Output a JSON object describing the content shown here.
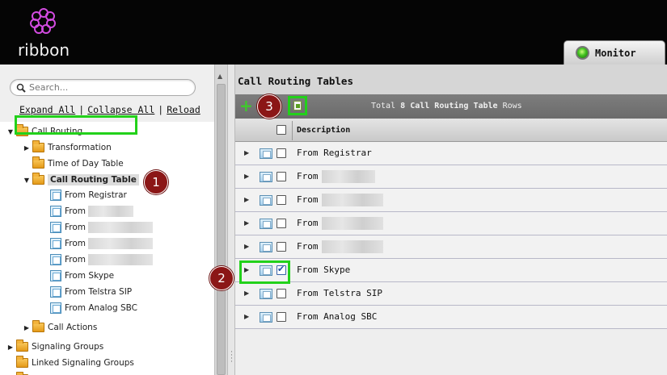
{
  "header": {
    "logo_text": "ribbon",
    "monitor_label": "Monitor"
  },
  "left_panel": {
    "search_placeholder": "Search...",
    "links": {
      "expand_all": "Expand All",
      "collapse_all": "Collapse All",
      "reload": "Reload",
      "separator": "|"
    },
    "tree": {
      "call_routing": "Call Routing",
      "transformation": "Transformation",
      "time_of_day_table": "Time of Day Table",
      "call_routing_table": "Call Routing Table",
      "children": [
        "From Registrar",
        "From",
        "From",
        "From",
        "From",
        "From Skype",
        "From Telstra SIP",
        "From Analog SBC"
      ],
      "call_actions": "Call Actions",
      "signaling_groups": "Signaling Groups",
      "linked_signaling_groups": "Linked Signaling Groups"
    }
  },
  "right_panel": {
    "title": "Call Routing Tables",
    "toolbar": {
      "total_prefix": "Total",
      "total_count": "8",
      "total_entity": "Call Routing Table",
      "total_suffix": "Rows"
    },
    "grid": {
      "column_description": "Description",
      "rows": [
        {
          "label": "From Registrar",
          "checked": false
        },
        {
          "label": "From",
          "checked": false
        },
        {
          "label": "From",
          "checked": false
        },
        {
          "label": "From",
          "checked": false
        },
        {
          "label": "From",
          "checked": false
        },
        {
          "label": "From Skype",
          "checked": true
        },
        {
          "label": "From Telstra SIP",
          "checked": false
        },
        {
          "label": "From Analog SBC",
          "checked": false
        }
      ]
    }
  },
  "annotations": {
    "badge_1": "1",
    "badge_2": "2",
    "badge_3": "3",
    "highlight_color": "#22d11a",
    "badge_color": "#8b1616"
  },
  "icons": {
    "logo": "ribbon-logo-icon",
    "monitor": "status-led-icon",
    "search": "search-icon",
    "add": "plus-icon",
    "copy": "copy-icon",
    "folder": "folder-icon",
    "table": "table-icon"
  }
}
